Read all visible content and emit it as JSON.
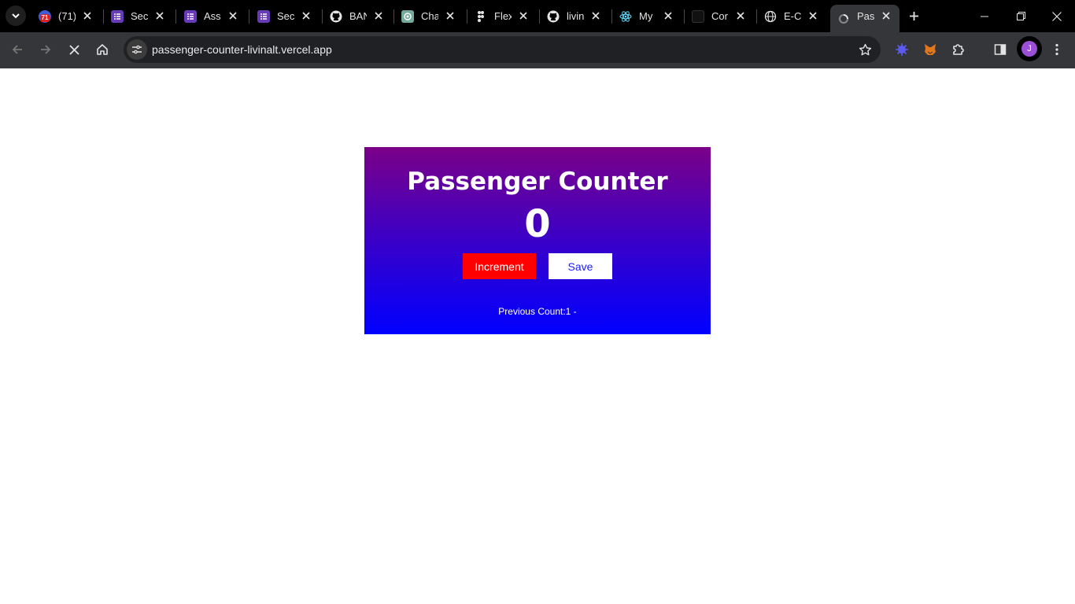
{
  "tabs": [
    {
      "title": "(71)",
      "icon": "notification-badge-icon",
      "badge": "71"
    },
    {
      "title": "Secu",
      "icon": "forms-list-icon"
    },
    {
      "title": "Asse",
      "icon": "forms-list-icon"
    },
    {
      "title": "Secu",
      "icon": "forms-list-icon"
    },
    {
      "title": "BAN",
      "icon": "github-icon"
    },
    {
      "title": "Cha",
      "icon": "chatgpt-icon"
    },
    {
      "title": "Flex",
      "icon": "figma-icon"
    },
    {
      "title": "livin",
      "icon": "github-icon"
    },
    {
      "title": "My",
      "icon": "react-icon"
    },
    {
      "title": "Cor",
      "icon": "dark-square-icon"
    },
    {
      "title": "E-C",
      "icon": "globe-icon"
    },
    {
      "title": "Pas",
      "icon": "loading-icon"
    }
  ],
  "toolbar": {
    "url": "passenger-counter-livinalt.vercel.app",
    "avatar_initial": "J"
  },
  "counter": {
    "title": "Passenger Counter",
    "count": "0",
    "increment_label": "Increment",
    "save_label": "Save",
    "previous": "Previous Count:1 -"
  },
  "colors": {
    "gradient_top": "#7b0088",
    "gradient_bottom": "#0000ff",
    "increment_bg": "#ff0000",
    "save_text": "#1a1aff"
  }
}
